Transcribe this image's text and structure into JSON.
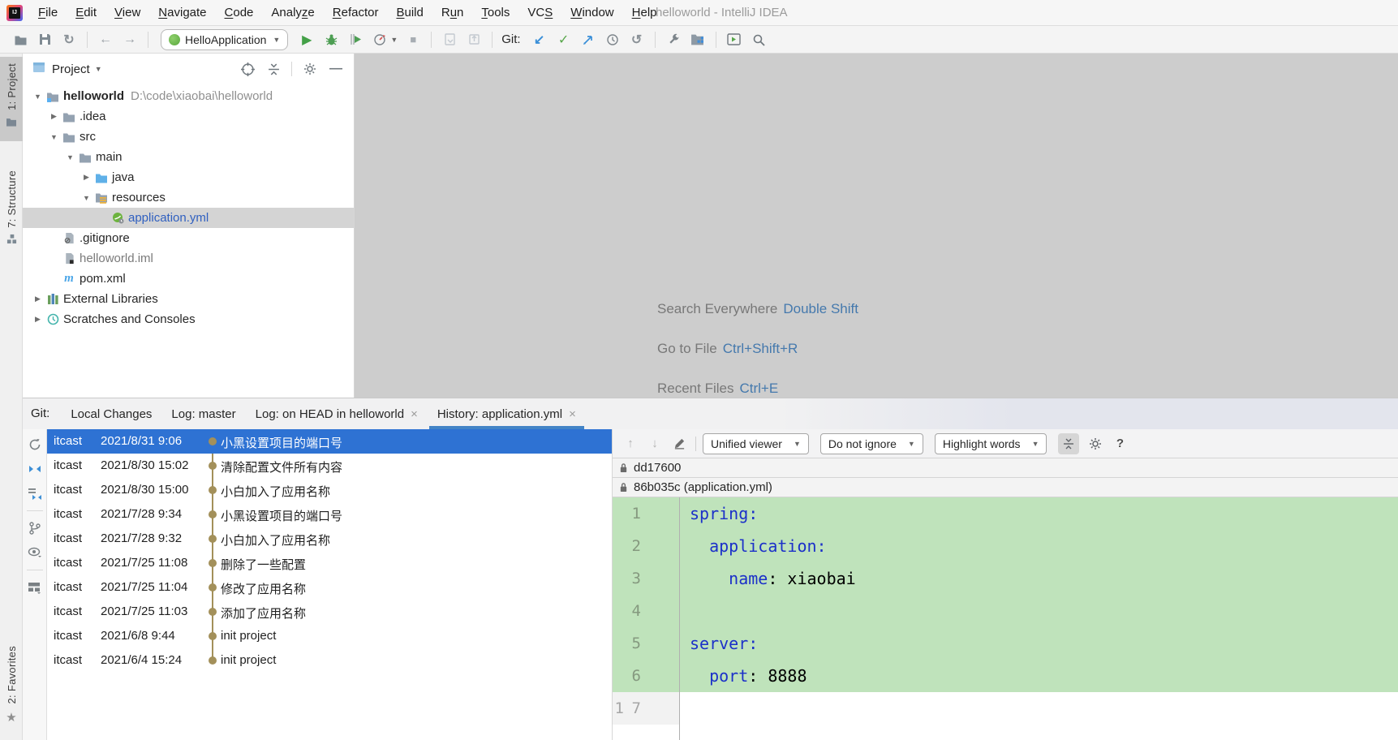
{
  "window": {
    "title": "helloworld - IntelliJ IDEA"
  },
  "menu": {
    "items": [
      {
        "label": "File",
        "mn": 0
      },
      {
        "label": "Edit",
        "mn": 0
      },
      {
        "label": "View",
        "mn": 0
      },
      {
        "label": "Navigate",
        "mn": 0
      },
      {
        "label": "Code",
        "mn": 0
      },
      {
        "label": "Analyze",
        "mn": 5
      },
      {
        "label": "Refactor",
        "mn": 0
      },
      {
        "label": "Build",
        "mn": 0
      },
      {
        "label": "Run",
        "mn": 1
      },
      {
        "label": "Tools",
        "mn": 0
      },
      {
        "label": "VCS",
        "mn": 2
      },
      {
        "label": "Window",
        "mn": 0
      },
      {
        "label": "Help",
        "mn": 0
      }
    ]
  },
  "toolbar": {
    "run_config": "HelloApplication",
    "git_label": "Git:"
  },
  "stripes": {
    "project": "1: Project",
    "structure": "7: Structure",
    "favorites": "2: Favorites"
  },
  "project_panel": {
    "title": "Project",
    "tree": [
      {
        "depth": 0,
        "chevron": "down",
        "icon": "project-folder",
        "label": "helloworld",
        "bold": true,
        "path": "D:\\code\\xiaobai\\helloworld"
      },
      {
        "depth": 1,
        "chevron": "right",
        "icon": "folder",
        "label": ".idea"
      },
      {
        "depth": 1,
        "chevron": "down",
        "icon": "folder",
        "label": "src"
      },
      {
        "depth": 2,
        "chevron": "down",
        "icon": "folder",
        "label": "main"
      },
      {
        "depth": 3,
        "chevron": "right",
        "icon": "java-folder",
        "label": "java"
      },
      {
        "depth": 3,
        "chevron": "down",
        "icon": "resources-folder",
        "label": "resources"
      },
      {
        "depth": 4,
        "chevron": "none",
        "icon": "spring-yml",
        "label": "application.yml",
        "selected": true,
        "blue": true
      },
      {
        "depth": 1,
        "chevron": "none",
        "icon": "gitignore-file",
        "label": ".gitignore"
      },
      {
        "depth": 1,
        "chevron": "none",
        "icon": "iml-file",
        "label": "helloworld.iml",
        "muted": true
      },
      {
        "depth": 1,
        "chevron": "none",
        "icon": "maven-file",
        "label": "pom.xml"
      },
      {
        "depth": 0,
        "chevron": "right",
        "icon": "libraries",
        "label": "External Libraries"
      },
      {
        "depth": 0,
        "chevron": "right",
        "icon": "scratches",
        "label": "Scratches and Consoles"
      }
    ]
  },
  "editor_hints": [
    {
      "label": "Search Everywhere",
      "shortcut": "Double Shift"
    },
    {
      "label": "Go to File",
      "shortcut": "Ctrl+Shift+R"
    },
    {
      "label": "Recent Files",
      "shortcut": "Ctrl+E"
    }
  ],
  "git_panel": {
    "label": "Git:",
    "tabs": [
      {
        "label": "Local Changes",
        "closable": false,
        "active": false
      },
      {
        "label": "Log: master",
        "closable": false,
        "active": false
      },
      {
        "label": "Log: on HEAD in helloworld",
        "closable": true,
        "active": false
      },
      {
        "label": "History: application.yml",
        "closable": true,
        "active": true
      }
    ],
    "commits": [
      {
        "author": "itcast",
        "date": "2021/8/31 9:06",
        "message": "小黑设置项目的端口号",
        "selected": true
      },
      {
        "author": "itcast",
        "date": "2021/8/30 15:02",
        "message": "清除配置文件所有内容",
        "selected": false
      },
      {
        "author": "itcast",
        "date": "2021/8/30 15:00",
        "message": "小白加入了应用名称",
        "selected": false
      },
      {
        "author": "itcast",
        "date": "2021/7/28 9:34",
        "message": "小黑设置项目的端口号",
        "selected": false
      },
      {
        "author": "itcast",
        "date": "2021/7/28 9:32",
        "message": "小白加入了应用名称",
        "selected": false
      },
      {
        "author": "itcast",
        "date": "2021/7/25 11:08",
        "message": "删除了一些配置",
        "selected": false
      },
      {
        "author": "itcast",
        "date": "2021/7/25 11:04",
        "message": "修改了应用名称",
        "selected": false
      },
      {
        "author": "itcast",
        "date": "2021/7/25 11:03",
        "message": "添加了应用名称",
        "selected": false
      },
      {
        "author": "itcast",
        "date": "2021/6/8 9:44",
        "message": "init project",
        "selected": false
      },
      {
        "author": "itcast",
        "date": "2021/6/4 15:24",
        "message": "init project",
        "selected": false
      }
    ]
  },
  "diff_panel": {
    "toolbar": {
      "viewer_select": "Unified viewer",
      "ignore_select": "Do not ignore",
      "highlight_select": "Highlight words",
      "help_label": "?"
    },
    "revisions": [
      "dd17600",
      "86b035c (application.yml)"
    ],
    "code_lines": [
      {
        "old": "",
        "new": "1",
        "added": true,
        "segs": [
          {
            "t": "spring:",
            "k": true
          }
        ]
      },
      {
        "old": "",
        "new": "2",
        "added": true,
        "segs": [
          {
            "t": "  "
          },
          {
            "t": "application:",
            "k": true
          }
        ]
      },
      {
        "old": "",
        "new": "3",
        "added": true,
        "segs": [
          {
            "t": "    "
          },
          {
            "t": "name",
            "k": true
          },
          {
            "t": ": xiaobai"
          }
        ]
      },
      {
        "old": "",
        "new": "4",
        "added": true,
        "segs": []
      },
      {
        "old": "",
        "new": "5",
        "added": true,
        "segs": [
          {
            "t": "server:",
            "k": true
          }
        ]
      },
      {
        "old": "",
        "new": "6",
        "added": true,
        "segs": [
          {
            "t": "  "
          },
          {
            "t": "port",
            "k": true
          },
          {
            "t": ": 8888"
          }
        ]
      },
      {
        "old": "1",
        "new": "7",
        "added": false,
        "segs": []
      }
    ]
  },
  "colors": {
    "selection_blue": "#2e72d3",
    "tab_underline": "#4384c6",
    "diff_added_green": "#bfe3bb",
    "yaml_key_blue": "#1b30c9",
    "timeline_tan": "#a3905a",
    "hint_link_blue": "#4579ad"
  }
}
